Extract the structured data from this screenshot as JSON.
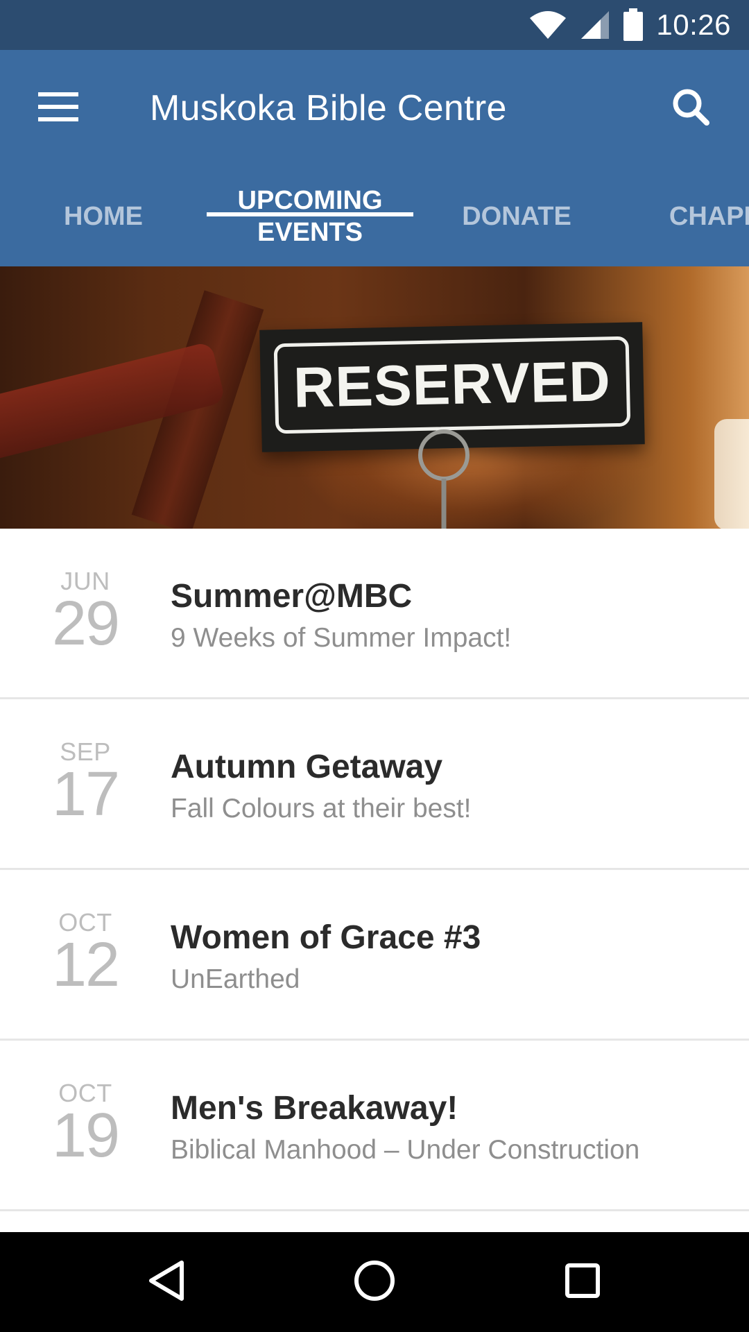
{
  "status_bar": {
    "time": "10:26",
    "icons": [
      "wifi-icon",
      "cell-signal-icon",
      "battery-icon"
    ]
  },
  "app_bar": {
    "title": "Muskoka Bible Centre",
    "menu_icon": "hamburger-menu-icon",
    "search_icon": "search-icon",
    "color": "#3b6ba0"
  },
  "tabs": [
    {
      "label": "HOME",
      "active": false
    },
    {
      "label": "UPCOMING\nEVENTS",
      "active": true
    },
    {
      "label": "DONATE",
      "active": false
    },
    {
      "label": "CHAPEL",
      "active": false
    }
  ],
  "banner": {
    "sign_text": "RESERVED"
  },
  "events": [
    {
      "month": "JUN",
      "day": "29",
      "title": "Summer@MBC",
      "subtitle": "9 Weeks of Summer Impact!"
    },
    {
      "month": "SEP",
      "day": "17",
      "title": "Autumn Getaway",
      "subtitle": "Fall Colours at their best!"
    },
    {
      "month": "OCT",
      "day": "12",
      "title": "Women of Grace #3",
      "subtitle": "UnEarthed"
    },
    {
      "month": "OCT",
      "day": "19",
      "title": "Men's Breakaway!",
      "subtitle": "Biblical Manhood – Under Construction"
    }
  ],
  "nav_bar": {
    "buttons": [
      "back-icon",
      "home-icon",
      "recents-icon"
    ]
  }
}
